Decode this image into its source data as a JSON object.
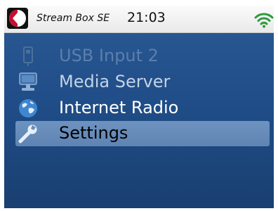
{
  "header": {
    "title": "Stream Box SE",
    "time": "21:03",
    "logo_icon": "brand-logo-icon",
    "status_icon": "wifi-signal-icon"
  },
  "menu": {
    "selected_index": 3,
    "items": [
      {
        "label": "USB Input 2",
        "icon": "usb-icon"
      },
      {
        "label": "Media Server",
        "icon": "computer-icon"
      },
      {
        "label": "Internet Radio",
        "icon": "globe-icon"
      },
      {
        "label": "Settings",
        "icon": "wrench-icon"
      }
    ]
  },
  "colors": {
    "screen_bg": "#1f4c86",
    "selection": "#6a8fbd",
    "header_bg": "#f2f2f2",
    "wifi": "#2e9a3e",
    "logo_red": "#c8102e"
  }
}
